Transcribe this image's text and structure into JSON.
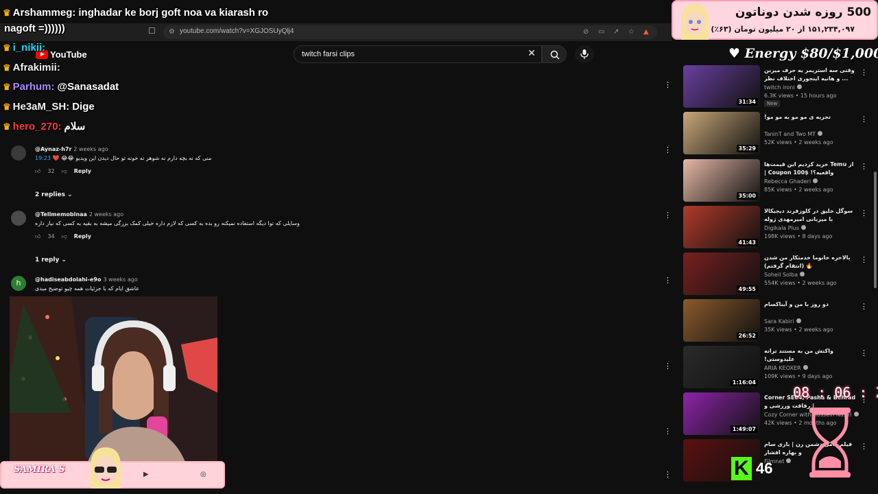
{
  "browser": {
    "url": "youtube.com/watch?v=XGJOSUyQlj4"
  },
  "youtube": {
    "logo_text": "YouTube",
    "search_query": "twitch farsi clips"
  },
  "chat": [
    {
      "user": "Arshammeg:",
      "message": "inghadar ke borj goft noa va kiarash ro",
      "user_color": "#ffffff"
    },
    {
      "user": "",
      "message": "nagoft =))))))",
      "user_color": "#ffffff"
    },
    {
      "user": "i_nikii:",
      "message": "",
      "user_color": "#00e5ff"
    },
    {
      "user": "Afrakimii:",
      "message": "",
      "user_color": "#ffffff"
    },
    {
      "user": "Parhum:",
      "message": "@Sanasadat",
      "user_color": "#a78bfa"
    },
    {
      "user": "He3aM_SH:",
      "message": "Dige",
      "user_color": "#ffffff"
    },
    {
      "user": "hero_270:",
      "message": "سلام",
      "user_color": "#ff3b3b"
    }
  ],
  "comments": [
    {
      "handle": "@Aynaz-h7r",
      "date": "2 weeks ago",
      "timestamp": "19:23",
      "text": "منی که نه بچه دارم نه شوهر نه خونه تو حال دیدن این ویدیو 😂😂 ❤️",
      "likes": "32",
      "reply_label": "Reply",
      "replies_label": "2 replies"
    },
    {
      "handle": "@Tellmemobinaa",
      "date": "2 weeks ago",
      "text": "وسایلی که توا دیگه استفاده نمیکنه رو بده به کسی که لازم داره خیلی کمک بزرگی میشه به بقیه به کسی که نیاز داره",
      "likes": "34",
      "reply_label": "Reply",
      "replies_label": "1 reply"
    },
    {
      "handle": "@hadiseabdolahi-e9o",
      "date": "3 weeks ago",
      "text": "عاشق ایام که با جزئیات همه چیو توضیح میدی"
    }
  ],
  "donation": {
    "title": "500 روزه شدن دوناتون",
    "subtitle": "۱۵۱,۲۳۴,۰۹۷ از ۲۰ میلیون تومان (۶۳٪)"
  },
  "energy": "♥ Energy $80/$1,000",
  "social": {
    "name": "SAMIRA S"
  },
  "recommended": [
    {
      "title": "وقتی سه استریمر یه حرف میزنن ... و هانیه اینجوری اختلاف نظر داره",
      "channel": "twitch ironi",
      "views": "6.3K views • 15 hours ago",
      "duration": "31:34",
      "badge": "New",
      "thumb_color": "#6a3fa0"
    },
    {
      "title": "تجربه ی مو مو به مو مو!",
      "channel": "TaninT and Two MT",
      "views": "52K views • 2 weeks ago",
      "duration": "35:29",
      "badge": "",
      "thumb_color": "#c9a77a"
    },
    {
      "title": "از Temu خرید کردیم این قیمت‌ها واقعیه؟! Coupon 100$ |",
      "channel": "Rebecca Ghaderi",
      "views": "85K views • 2 weeks ago",
      "duration": "35:00",
      "badge": "",
      "thumb_color": "#e6b8a6"
    },
    {
      "title": "سوگل خلیق در کلوزفرند دیجیکالا با میزبانی امیرمهدی ژوله",
      "channel": "Digikala Plus",
      "views": "198K views • 8 days ago",
      "duration": "41:43",
      "badge": "",
      "thumb_color": "#b23a2a"
    },
    {
      "title": "بالاخره خانوما خدمتکار من شدن 🔥 (انتقام گرفتم)",
      "channel": "Soheil Solba",
      "views": "554K views • 2 weeks ago",
      "duration": "49:55",
      "badge": "",
      "thumb_color": "#7a2020"
    },
    {
      "title": "دو روز با من و آیناکسام",
      "channel": "Sara Kabiri",
      "views": "35K views • 2 weeks ago",
      "duration": "26:52",
      "badge": "",
      "thumb_color": "#8b5a2b"
    },
    {
      "title": "واکنش من به مستند ترانه علیدوستی!",
      "channel": "ARIA KEOXER",
      "views": "109K views • 9 days ago",
      "duration": "1:16:04",
      "badge": "",
      "thumb_color": "#2a2a2a"
    },
    {
      "title": "Corner SE04, Pasha & Behrad | رفاقت ورزشی و",
      "channel": "Cozy Corner with Hossein Nasiri",
      "views": "42K views • 2 months ago",
      "duration": "1:49:07",
      "badge": "",
      "thumb_color": "#8e24aa"
    },
    {
      "title": "فیلم کامل دشمن زن | بازی سام و بهاره افشار",
      "channel": "Filmnet",
      "views": "",
      "duration": "",
      "badge": "",
      "thumb_color": "#5d1010"
    }
  ],
  "timer": "08 : 06 : 26",
  "kick": {
    "count": "46"
  },
  "colors": {
    "accent_red": "#ff0000",
    "donation_bg": "#ffd6e0",
    "kick_green": "#53fc18",
    "link_blue": "#3ea6ff"
  }
}
